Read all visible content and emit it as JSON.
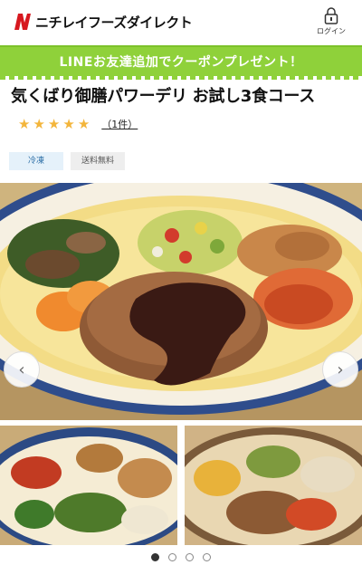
{
  "header": {
    "brand": "ニチレイフーズダイレクト",
    "login_label": "ログイン",
    "icons": {
      "logo": "nichirei-n-logo",
      "login": "lock-icon"
    }
  },
  "line_banner": {
    "text": "LINEお友達追加でクーポンプレゼント！"
  },
  "product": {
    "title": "気くばり御膳パワーデリ お試し3食コース",
    "rating": {
      "stars": 5,
      "max": 5,
      "review_label": "（1件）"
    },
    "tags": [
      "冷凍",
      "送料無料"
    ]
  },
  "carousel": {
    "prev_label": "‹",
    "next_label": "›",
    "slide_count": 4,
    "active_index": 0
  },
  "colors": {
    "line_green": "#8fd13a",
    "star": "#f3b53b",
    "brand_red": "#d7181f",
    "tag_frozen_bg": "#e5f1fa",
    "tag_frozen_text": "#2c6ea6"
  }
}
